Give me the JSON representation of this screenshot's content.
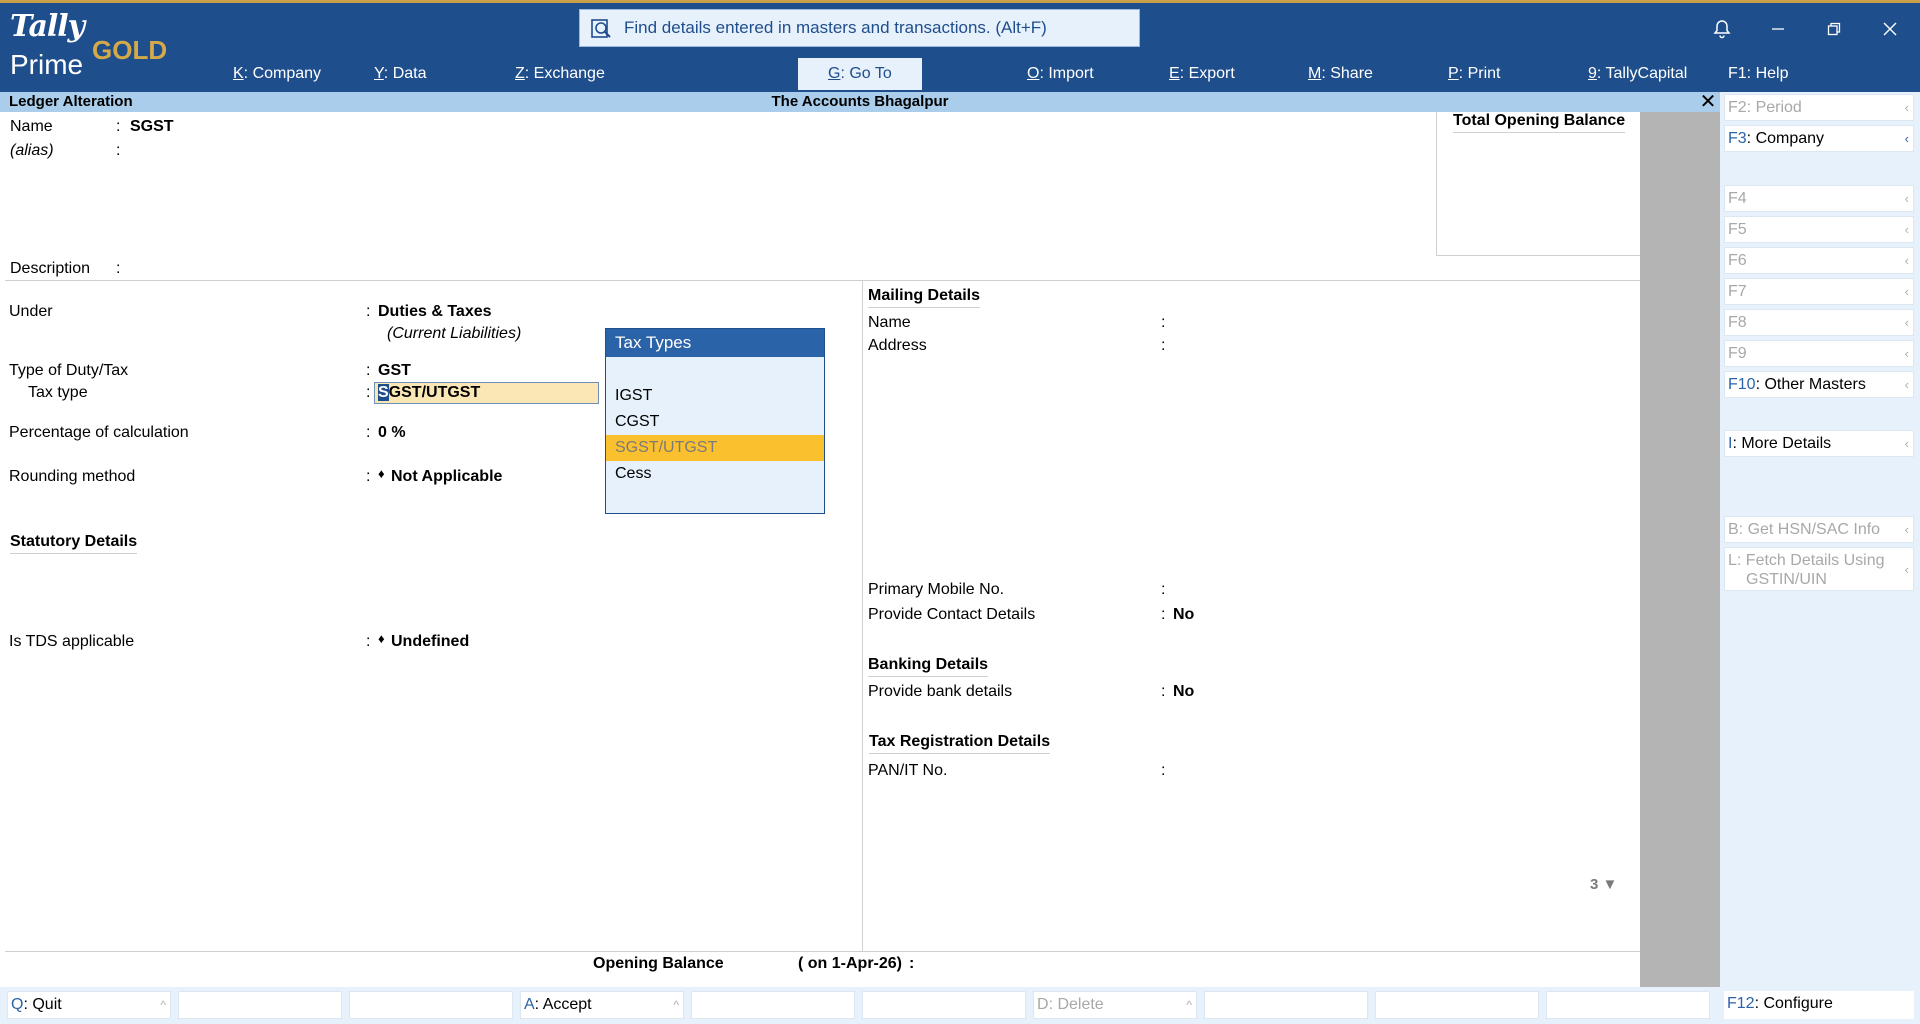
{
  "app": {
    "logo_tally": "Tally",
    "logo_prime": "Prime",
    "logo_gold": "GOLD",
    "search_text": "Find details entered in masters and transactions. (Alt+F)"
  },
  "menu": [
    {
      "key": "K",
      "label": "Company"
    },
    {
      "key": "Y",
      "label": "Data"
    },
    {
      "key": "Z",
      "label": "Exchange"
    },
    {
      "key": "G",
      "label": "Go To"
    },
    {
      "key": "O",
      "label": "Import"
    },
    {
      "key": "E",
      "label": "Export"
    },
    {
      "key": "M",
      "label": "Share"
    },
    {
      "key": "P",
      "label": "Print"
    },
    {
      "key": "9",
      "label": "TallyCapital"
    },
    {
      "key": "F1",
      "label": "Help"
    }
  ],
  "titlebar": {
    "screen": "Ledger Alteration",
    "company": "The Accounts Bhagalpur"
  },
  "form": {
    "name_label": "Name",
    "name_value": "SGST",
    "alias_label": "(alias)",
    "description_label": "Description",
    "total_opening_balance": "Total Opening Balance",
    "under_label": "Under",
    "under_value": "Duties & Taxes",
    "under_sub": "(Current Liabilities)",
    "duty_type_label": "Type of Duty/Tax",
    "duty_type_value": "GST",
    "tax_type_label": "Tax type",
    "tax_type_first": "S",
    "tax_type_rest": "GST/UTGST",
    "percentage_label": "Percentage of calculation",
    "percentage_value": "0 %",
    "rounding_label": "Rounding method",
    "rounding_value": "Not Applicable",
    "statutory_header": "Statutory Details",
    "tds_label": "Is TDS applicable",
    "tds_value": "Undefined",
    "colon": ":",
    "diamond": "♦"
  },
  "right_panel": {
    "mailing_header": "Mailing Details",
    "name_label": "Name",
    "address_label": "Address",
    "mobile_label": "Primary Mobile No.",
    "contact_label": "Provide Contact Details",
    "contact_value": "No",
    "banking_header": "Banking Details",
    "bank_label": "Provide bank details",
    "bank_value": "No",
    "taxreg_header": "Tax Registration Details",
    "pan_label": "PAN/IT No.",
    "page_indicator": "3 ▼"
  },
  "popup": {
    "title": "Tax Types",
    "items": [
      "IGST",
      "CGST",
      "SGST/UTGST",
      "Cess"
    ],
    "selected": "SGST/UTGST"
  },
  "opening_balance": {
    "label": "Opening Balance",
    "date": "( on 1-Apr-26)",
    "colon": ":"
  },
  "sidebar": [
    {
      "key": "F2",
      "label": "Period",
      "disabled": true
    },
    {
      "key": "F3",
      "label": "Company",
      "disabled": false
    },
    {
      "key": "F4",
      "label": "",
      "disabled": true
    },
    {
      "key": "F5",
      "label": "",
      "disabled": true
    },
    {
      "key": "F6",
      "label": "",
      "disabled": true
    },
    {
      "key": "F7",
      "label": "",
      "disabled": true
    },
    {
      "key": "F8",
      "label": "",
      "disabled": true
    },
    {
      "key": "F9",
      "label": "",
      "disabled": true
    },
    {
      "key": "F10",
      "label": "Other Masters",
      "disabled": false
    },
    {
      "key": "I",
      "label": "More Details",
      "disabled": false
    },
    {
      "key": "B",
      "label": "Get HSN/SAC Info",
      "disabled": true
    },
    {
      "key": "L",
      "label": "Fetch Details Using",
      "label2": "GSTIN/UIN",
      "disabled": true
    }
  ],
  "bottom": [
    {
      "key": "Q",
      "label": "Quit"
    },
    {
      "key": "A",
      "label": "Accept"
    },
    {
      "key": "D",
      "label": "Delete"
    }
  ],
  "f12": {
    "key": "F12",
    "label": "Configure"
  },
  "colors": {
    "topbar": "#1f4e8c",
    "titlebar": "#a9cdea",
    "highlight": "#fbc02d",
    "gold": "#d4a94a"
  }
}
